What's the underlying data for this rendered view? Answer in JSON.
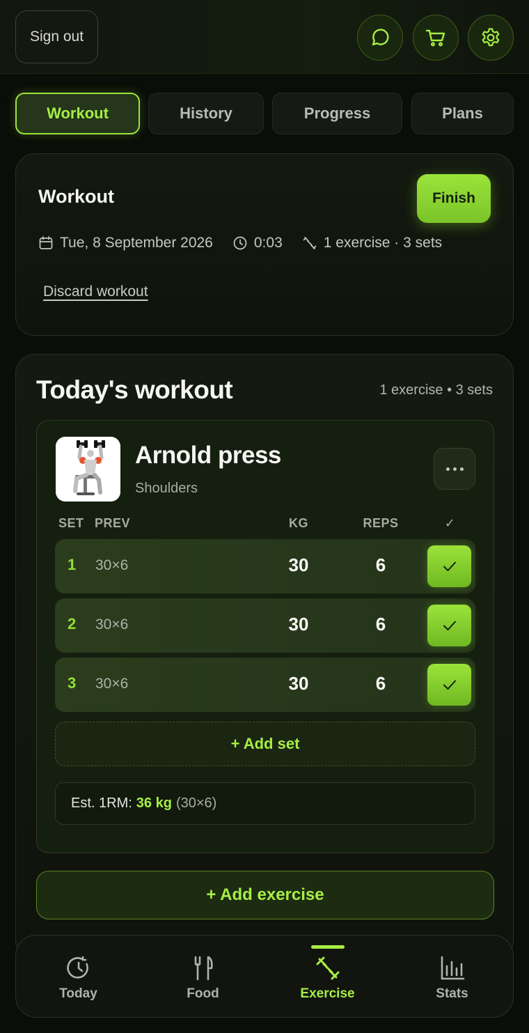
{
  "header": {
    "sign_out_label": "Sign out"
  },
  "tabs": [
    {
      "label": "Workout",
      "active": true
    },
    {
      "label": "History",
      "active": false
    },
    {
      "label": "Progress",
      "active": false
    },
    {
      "label": "Plans",
      "active": false
    }
  ],
  "session": {
    "title": "Workout",
    "finish_label": "Finish",
    "date": "Tue, 8 September 2026",
    "elapsed": "0:03",
    "summary": "1 exercise · 3 sets",
    "discard_label": "Discard workout"
  },
  "today": {
    "title": "Today's workout",
    "summary": "1 exercise • 3 sets"
  },
  "exercise": {
    "name": "Arnold press",
    "muscle": "Shoulders",
    "columns": {
      "set": "SET",
      "prev": "PREV",
      "kg": "KG",
      "reps": "REPS",
      "done": "✓"
    },
    "sets": [
      {
        "num": "1",
        "prev": "30×6",
        "kg": "30",
        "reps": "6",
        "done": true
      },
      {
        "num": "2",
        "prev": "30×6",
        "kg": "30",
        "reps": "6",
        "done": true
      },
      {
        "num": "3",
        "prev": "30×6",
        "kg": "30",
        "reps": "6",
        "done": true
      }
    ],
    "add_set_label": "+ Add set",
    "one_rm_label": "Est. 1RM:",
    "one_rm_value": "36 kg",
    "one_rm_detail": "(30×6)"
  },
  "add_exercise_label": "+ Add exercise",
  "nav": [
    {
      "label": "Today",
      "icon": "clock-history-icon",
      "active": false
    },
    {
      "label": "Food",
      "icon": "fork-knife-icon",
      "active": false
    },
    {
      "label": "Exercise",
      "icon": "dumbbell-icon",
      "active": true
    },
    {
      "label": "Stats",
      "icon": "bar-chart-icon",
      "active": false
    }
  ],
  "colors": {
    "accent": "#a6ee45",
    "background": "#0a0d08",
    "card": "#141a10"
  }
}
